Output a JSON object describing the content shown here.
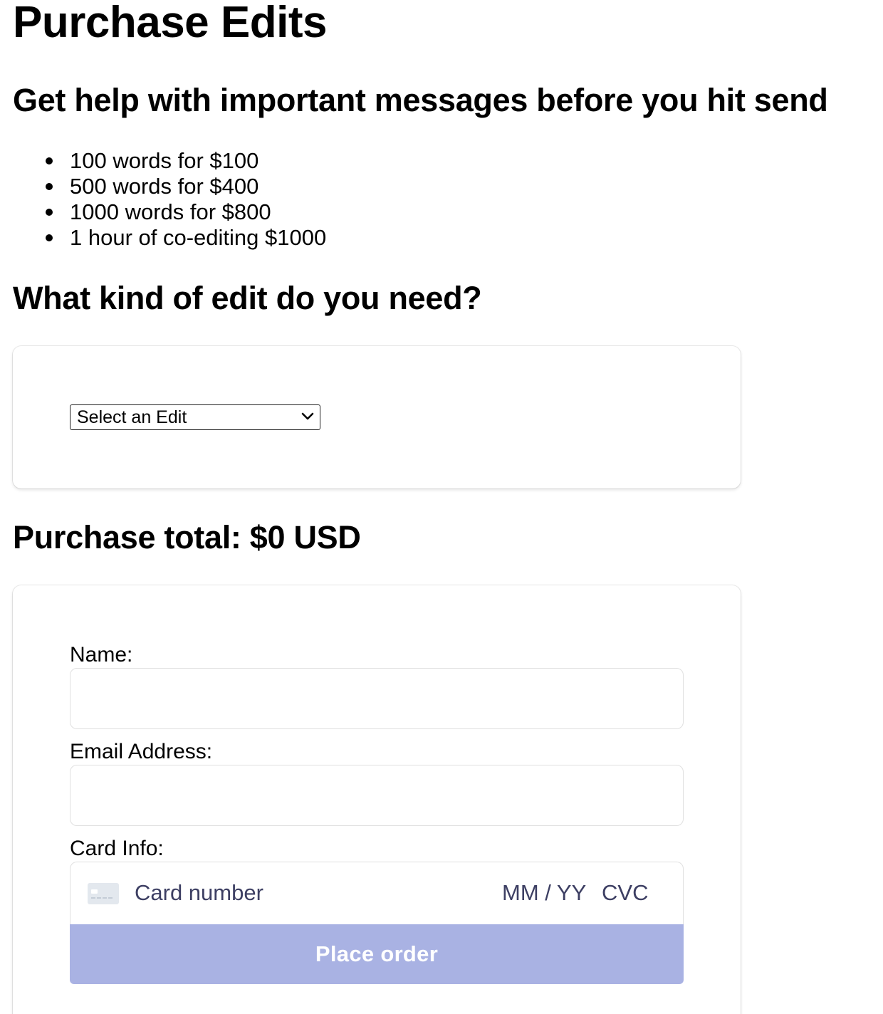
{
  "page": {
    "title": "Purchase Edits",
    "subtitle": "Get help with important messages before you hit send"
  },
  "pricing": {
    "items": [
      "100 words for $100",
      "500 words for $400",
      "1000 words for $800",
      "1 hour of co-editing $1000"
    ]
  },
  "edit_section": {
    "heading": "What kind of edit do you need?",
    "select_value": "Select an Edit"
  },
  "total": {
    "text": "Purchase total: $0 USD"
  },
  "payment_form": {
    "name_label": "Name:",
    "name_value": "",
    "email_label": "Email Address:",
    "email_value": "",
    "card_label": "Card Info:",
    "card_number_placeholder": "Card number",
    "expiry_placeholder": "MM / YY",
    "cvc_placeholder": "CVC",
    "card_icon": "credit-card-icon",
    "submit_label": "Place order"
  },
  "colors": {
    "button_bg": "#a9b2e3",
    "button_text": "#ffffff",
    "placeholder_text": "#3d3f63",
    "input_border": "#e0e0e0"
  }
}
